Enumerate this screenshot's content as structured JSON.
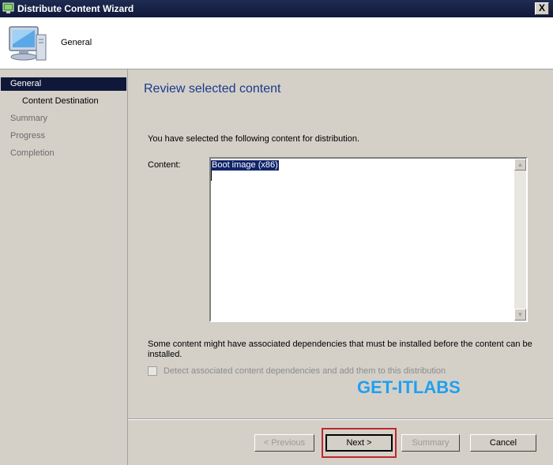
{
  "window": {
    "title": "Distribute Content Wizard",
    "close_glyph": "X"
  },
  "header": {
    "title": "General",
    "icon": "computer-monitor-icon"
  },
  "sidebar": {
    "items": [
      {
        "label": "General"
      },
      {
        "label": "Content Destination"
      },
      {
        "label": "Summary"
      },
      {
        "label": "Progress"
      },
      {
        "label": "Completion"
      }
    ]
  },
  "main": {
    "heading": "Review selected content",
    "intro": "You have selected the following content for distribution.",
    "content_label": "Content:",
    "content_items": [
      "Boot image (x86)"
    ],
    "dependencies_text": "Some content might have associated dependencies that must be installed before the content can be installed.",
    "dependencies_checkbox": {
      "label": "Detect associated content dependencies and add them to this distribution",
      "checked": false,
      "enabled": false
    },
    "watermark": "GET-ITLABS"
  },
  "buttons": {
    "previous": "< Previous",
    "next": "Next >",
    "summary": "Summary",
    "cancel": "Cancel"
  },
  "colors": {
    "titlebar": "#10183a",
    "selection": "#10183a",
    "heading": "#1a3a8a",
    "watermark": "#1ea0f0",
    "highlight": "#c0282d"
  }
}
